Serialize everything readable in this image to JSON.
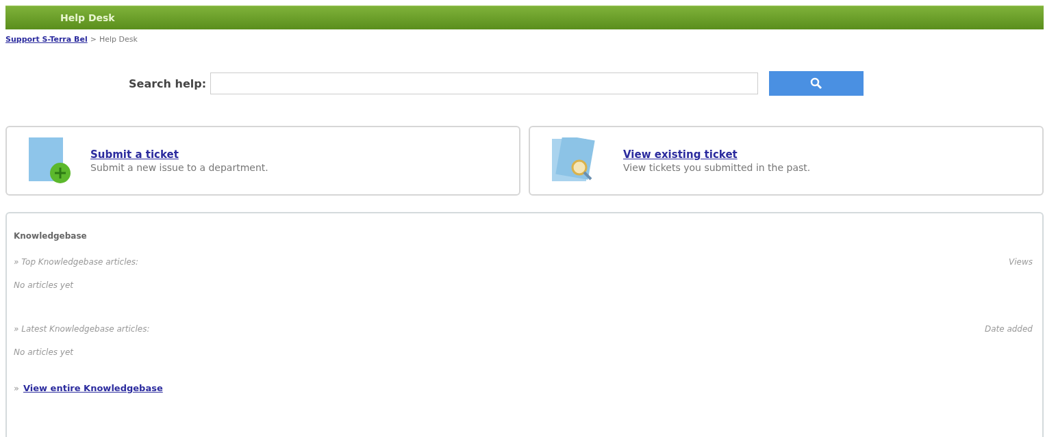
{
  "header": {
    "title": "Help Desk"
  },
  "breadcrumb": {
    "link": "Support S-Terra Bel",
    "separator": ">",
    "current": "Help Desk"
  },
  "search": {
    "label": "Search help:"
  },
  "actions": [
    {
      "kind": "submit",
      "title": "Submit a ticket",
      "description": "Submit a new issue to a department."
    },
    {
      "kind": "view",
      "title": "View existing ticket",
      "description": "View tickets you submitted in the past."
    }
  ],
  "knowledgebase": {
    "title": "Knowledgebase",
    "sections": [
      {
        "heading": "» Top Knowledgebase articles:",
        "column": "Views",
        "empty": "No articles yet"
      },
      {
        "heading": "» Latest Knowledgebase articles:",
        "column": "Date added",
        "empty": "No articles yet"
      }
    ],
    "footer": {
      "marker": "»",
      "link": "View entire Knowledgebase"
    }
  }
}
